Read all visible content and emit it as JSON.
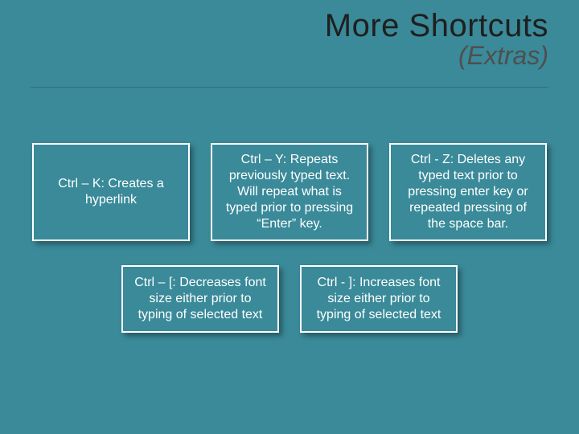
{
  "header": {
    "title": "More Shortcuts",
    "subtitle": "(Extras)"
  },
  "cards": {
    "r1c1": "Ctrl – K: Creates a hyperlink",
    "r1c2": "Ctrl – Y: Repeats previously typed text. Will repeat what is typed prior to pressing “Enter” key.",
    "r1c3": "Ctrl - Z: Deletes any typed text prior to pressing enter key or repeated pressing of the space bar.",
    "r2c1": "Ctrl – [: Decreases font size either prior to typing of selected text",
    "r2c2": "Ctrl - ]: Increases font size either prior to typing of selected text"
  }
}
